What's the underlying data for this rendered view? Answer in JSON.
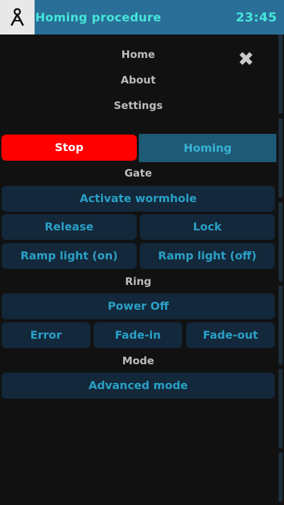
{
  "header": {
    "logo_icon": "stargate-figure-icon",
    "title": "Homing procedure",
    "clock": "23:45"
  },
  "nav": {
    "home": "Home",
    "about": "About",
    "settings": "Settings",
    "close_icon": "close-icon"
  },
  "controls": {
    "stop": "Stop",
    "homing": "Homing"
  },
  "gate": {
    "label": "Gate",
    "activate": "Activate wormhole",
    "release": "Release",
    "lock": "Lock",
    "ramp_on": "Ramp light (on)",
    "ramp_off": "Ramp light (off)"
  },
  "ring": {
    "label": "Ring",
    "power_off": "Power Off",
    "error": "Error",
    "fade_in": "Fade-in",
    "fade_out": "Fade-out"
  },
  "mode": {
    "label": "Mode",
    "advanced": "Advanced mode"
  },
  "colors": {
    "header_bg": "#2a6f98",
    "accent_text": "#46e6d8",
    "button_bg": "#13283a",
    "button_text": "#2aa0c6",
    "stop_bg": "#ff0000"
  }
}
